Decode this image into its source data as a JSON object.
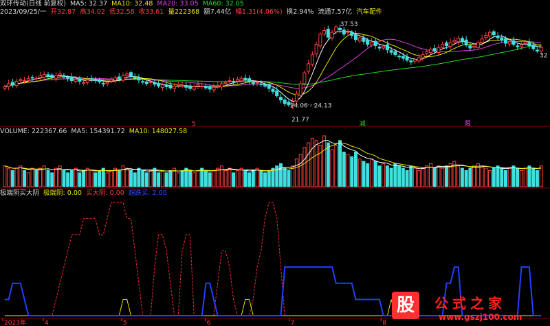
{
  "header1": {
    "stock": "双环传动(日线 前复权)",
    "ma5": "MA5: 32.37",
    "ma10": "MA10: 32.48",
    "ma20": "MA20: 33.05",
    "ma60": "MA60: 32.05"
  },
  "header2": {
    "date": "2023/09/25/一",
    "open": "开32.87",
    "high": "高34.02",
    "low": "低32.58",
    "close": "收33.61",
    "vol": "量222368",
    "amount": "额7.44亿",
    "range": "幅1.31(4.06%)",
    "turnover": "换2.94%",
    "float": "流通7.57亿",
    "sector": "汽车配件"
  },
  "header3": {
    "volume": "VOLUME: 222367.66",
    "ma5": "MA5: 154391.72",
    "ma10": "MA10: 148027.58"
  },
  "header4": {
    "name": "极端阴买大阴",
    "l1": "极端阴: 0.00",
    "l2": "买大阴: 0.00",
    "l3": "超跌买: 2.00"
  },
  "annotations": {
    "high": "37.53",
    "low": "21.77",
    "range": "24.06 - 24.13",
    "right": "32"
  },
  "markers": [
    "5",
    "减",
    "限"
  ],
  "logo": {
    "glyph": "股",
    "text": "公式之家",
    "url": "www.gszj100.com"
  },
  "chart_data": {
    "type": "candlestick",
    "x_labels": [
      "2023年",
      "4",
      "5",
      "6",
      "7",
      "8"
    ],
    "price_range": [
      21.77,
      37.53
    ],
    "colors": {
      "up": "#ff4040",
      "down": "#40e0e0",
      "ma5": "#ffffff",
      "ma10": "#e8e800",
      "ma20": "#e040e0",
      "ma60": "#20e020"
    },
    "close": [
      27.1,
      27.6,
      27.4,
      28.0,
      28.3,
      28.1,
      28.4,
      28.6,
      28.5,
      28.9,
      29.1,
      28.8,
      28.6,
      28.9,
      29.2,
      28.7,
      28.5,
      28.1,
      28.3,
      28.0,
      27.8,
      28.2,
      28.4,
      28.1,
      27.9,
      27.6,
      27.8,
      28.3,
      28.6,
      28.4,
      28.9,
      29.2,
      28.8,
      28.5,
      28.2,
      27.9,
      27.6,
      27.9,
      27.5,
      27.2,
      27.4,
      27.1,
      26.9,
      27.2,
      27.5,
      27.3,
      27.0,
      26.8,
      27.1,
      27.4,
      27.2,
      26.9,
      26.7,
      27.0,
      27.3,
      27.6,
      27.8,
      28.1,
      27.9,
      28.3,
      28.5,
      28.2,
      27.9,
      27.6,
      27.8,
      27.5,
      27.2,
      26.8,
      26.3,
      25.6,
      24.9,
      24.3,
      24.1,
      24.6,
      25.9,
      27.6,
      29.4,
      30.9,
      32.4,
      34.1,
      35.8,
      36.4,
      35.3,
      36.1,
      37.0,
      36.5,
      35.8,
      36.2,
      35.6,
      34.9,
      35.2,
      34.6,
      34.1,
      34.5,
      33.9,
      33.5,
      33.8,
      33.2,
      32.8,
      32.4,
      32.1,
      31.8,
      31.5,
      31.2,
      31.6,
      31.9,
      32.4,
      32.9,
      33.3,
      33.0,
      33.6,
      34.1,
      33.9,
      34.4,
      34.8,
      35.1,
      34.6,
      34.0,
      33.5,
      33.8,
      34.4,
      35.0,
      35.6,
      36.1,
      35.7,
      35.2,
      34.8,
      34.3,
      34.6,
      34.1,
      33.7,
      34.0,
      34.5,
      33.9,
      33.4,
      33.0,
      33.6
    ],
    "volume": [
      9,
      8,
      7,
      8,
      9,
      7,
      6,
      8,
      7,
      8,
      9,
      7,
      6,
      8,
      9,
      7,
      6,
      7,
      8,
      6,
      7,
      8,
      7,
      6,
      7,
      8,
      6,
      7,
      8,
      7,
      9,
      8,
      7,
      6,
      8,
      7,
      6,
      7,
      8,
      6,
      7,
      6,
      7,
      8,
      6,
      7,
      8,
      7,
      6,
      7,
      8,
      7,
      6,
      7,
      8,
      9,
      7,
      8,
      6,
      7,
      8,
      7,
      6,
      7,
      8,
      7,
      6,
      7,
      8,
      9,
      10,
      8,
      7,
      9,
      12,
      14,
      17,
      19,
      21,
      20,
      18,
      22,
      19,
      16,
      18,
      20,
      15,
      14,
      13,
      15,
      12,
      11,
      10,
      12,
      11,
      9,
      10,
      9,
      8,
      10,
      9,
      8,
      7,
      9,
      8,
      7,
      8,
      9,
      10,
      8,
      9,
      8,
      9,
      10,
      11,
      9,
      8,
      7,
      8,
      9,
      10,
      9,
      8,
      7,
      8,
      9,
      8,
      7,
      8,
      9,
      8,
      7,
      8,
      9,
      8,
      7,
      9
    ],
    "series": [
      {
        "name": "极端阴",
        "color": "#ff3030",
        "values": [
          0,
          0,
          0,
          0,
          0,
          0,
          0,
          0,
          0,
          0,
          0,
          0,
          0,
          1,
          2,
          3,
          4,
          5,
          5,
          5,
          6,
          6,
          6,
          6,
          5,
          5,
          6,
          7,
          7,
          7,
          7,
          6,
          6,
          4,
          2,
          0,
          0,
          0,
          3,
          5,
          5,
          4,
          2,
          0,
          0,
          4,
          5,
          5,
          0,
          0,
          0,
          0,
          0,
          0,
          2,
          4,
          4,
          3,
          1,
          0,
          0,
          0,
          0,
          1,
          3,
          4,
          6,
          7,
          7,
          6,
          3,
          0,
          0,
          0,
          0,
          0,
          0,
          0,
          0,
          0,
          0,
          0,
          0,
          0,
          0,
          0,
          0,
          0,
          0,
          0,
          0,
          0,
          0,
          0,
          0,
          0,
          0,
          0,
          0,
          0,
          0,
          0,
          0,
          0,
          0,
          0,
          0,
          0,
          0,
          0,
          0,
          0,
          0,
          0,
          0,
          0,
          0,
          0,
          0,
          0,
          0,
          0,
          0,
          0,
          0,
          0,
          0,
          0,
          0,
          0,
          0,
          0,
          0,
          0,
          0,
          0,
          0
        ]
      },
      {
        "name": "买大阴",
        "color": "#e8e800",
        "values": [
          0,
          0,
          0,
          0,
          0,
          0,
          0,
          0,
          0,
          0,
          0,
          0,
          0,
          0,
          0,
          0,
          0,
          0,
          0,
          0,
          0,
          0,
          0,
          0,
          0,
          0,
          0,
          0,
          0,
          0,
          1,
          1,
          0,
          0,
          0,
          0,
          0,
          0,
          0,
          0,
          0,
          0,
          0,
          0,
          0,
          0,
          0,
          0,
          0,
          0,
          0,
          0,
          0,
          0,
          0,
          0,
          0,
          0,
          0,
          0,
          0,
          1,
          1,
          0,
          0,
          0,
          0,
          0,
          0,
          0,
          0,
          0,
          0,
          0,
          0,
          0,
          0,
          0,
          0,
          0,
          0,
          0,
          0,
          0,
          0,
          0,
          0,
          0,
          0,
          0,
          0,
          0,
          0,
          0,
          0,
          0,
          0,
          0,
          1,
          0,
          0,
          0,
          0,
          1,
          1,
          0,
          0,
          0,
          0,
          0,
          0,
          0,
          0,
          0,
          0,
          0,
          0,
          0,
          0,
          0,
          0,
          0,
          0,
          0,
          0,
          0,
          0,
          0,
          0,
          0,
          0,
          0,
          0,
          0,
          0,
          0,
          0
        ]
      },
      {
        "name": "超跌买",
        "color": "#2040ff",
        "values": [
          1,
          1,
          2,
          2,
          2,
          1,
          0,
          0,
          0,
          0,
          0,
          0,
          0,
          0,
          0,
          0,
          0,
          0,
          0,
          0,
          0,
          0,
          0,
          0,
          0,
          0,
          0,
          0,
          0,
          0,
          0,
          0,
          0,
          0,
          0,
          0,
          0,
          0,
          0,
          0,
          0,
          0,
          0,
          0,
          0,
          0,
          0,
          0,
          0,
          0,
          0,
          2,
          2,
          1,
          0,
          0,
          0,
          0,
          0,
          0,
          0,
          0,
          0,
          0,
          0,
          0,
          0,
          0,
          0,
          0,
          0,
          3,
          3,
          3,
          3,
          3,
          3,
          3,
          3,
          3,
          3,
          3,
          3,
          3,
          2,
          2,
          2,
          2,
          2,
          1,
          1,
          1,
          1,
          1,
          1,
          1,
          0,
          0,
          0,
          0,
          0,
          0,
          0,
          0,
          0,
          0,
          0,
          0,
          0,
          0,
          0,
          0,
          2,
          2,
          3,
          3,
          0,
          0,
          0,
          0,
          0,
          0,
          0,
          0,
          0,
          0,
          0,
          0,
          0,
          0,
          0,
          3,
          3,
          3,
          0,
          0,
          0
        ]
      }
    ]
  }
}
